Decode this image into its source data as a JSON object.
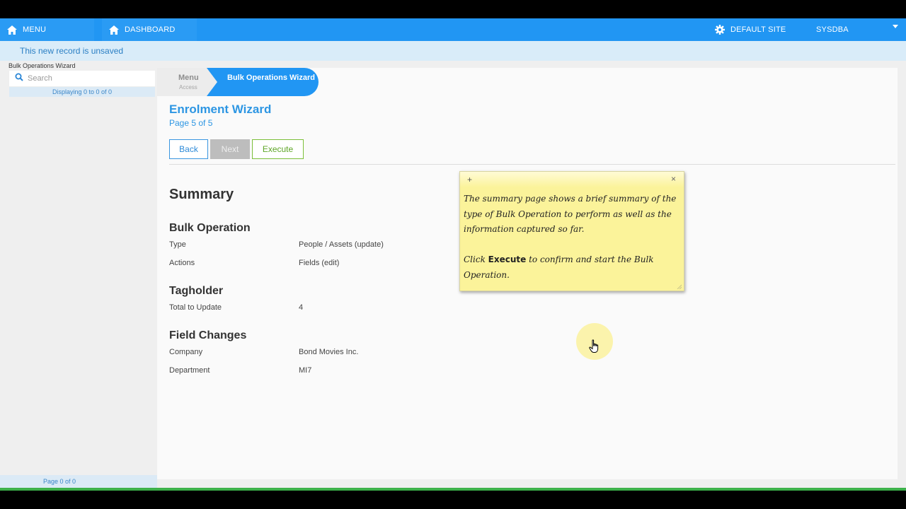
{
  "topbar": {
    "menu_label": "MENU",
    "dashboard_label": "DASHBOARD",
    "site_label": "DEFAULT SITE",
    "user_label": "SYSDBA"
  },
  "banner": {
    "unsaved_text": "This new record is unsaved"
  },
  "left_panel": {
    "title": "Bulk Operations Wizard",
    "search_placeholder": "Search",
    "display_count": "Displaying 0 to 0 of 0",
    "footer": "Page 0 of 0"
  },
  "breadcrumb": {
    "menu": "Menu",
    "menu_sub": "Access",
    "active": "Bulk Operations Wizard"
  },
  "wizard": {
    "title": "Enrolment Wizard",
    "page": "Page 5 of 5",
    "back_label": "Back",
    "next_label": "Next",
    "execute_label": "Execute"
  },
  "summary": {
    "title": "Summary",
    "bulk_operation": {
      "title": "Bulk Operation",
      "rows": [
        {
          "label": "Type",
          "value": "People / Assets (update)"
        },
        {
          "label": "Actions",
          "value": "Fields (edit)"
        }
      ]
    },
    "tagholder": {
      "title": "Tagholder",
      "rows": [
        {
          "label": "Total to Update",
          "value": "4"
        }
      ]
    },
    "field_changes": {
      "title": "Field Changes",
      "rows": [
        {
          "label": "Company",
          "value": "Bond Movies Inc."
        },
        {
          "label": "Department",
          "value": "MI7"
        }
      ]
    }
  },
  "note": {
    "plus": "+",
    "close": "×",
    "para1": "The summary page shows a brief summary of the type of Bulk Operation to perform as well as the information captured so far.",
    "para2_pre": "Click ",
    "para2_bold": "Execute",
    "para2_post": " to confirm and start the Bulk Operation."
  },
  "colors": {
    "nav_blue": "#2196f3",
    "link_blue": "#2d96e3",
    "execute_green": "#5ea626",
    "note_yellow": "#fbf39a"
  },
  "icons": [
    "home-icon",
    "gear-icon",
    "search-icon",
    "dropdown-arrow-icon",
    "hand-cursor-icon"
  ]
}
